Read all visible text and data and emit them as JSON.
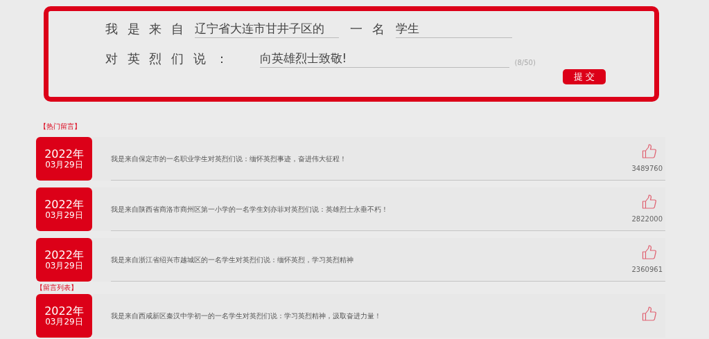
{
  "form": {
    "from_label": "我 是 来 自",
    "from_value": "辽宁省大连市甘井子区的",
    "role_label": "一 名",
    "role_value": "学生",
    "say_label": "对 英 烈 们 说 ：",
    "message_value": "向英雄烈士致敬!",
    "counter": "(8/50)",
    "submit": "提 交"
  },
  "sections": [
    {
      "title": "【热门留言】",
      "messages": [
        {
          "year": "2022年",
          "date": "03月29日",
          "text": "我是来自保定市的一名职业学生对英烈们说：缅怀英烈事迹，奋进伟大征程！",
          "likes": "3489760"
        },
        {
          "year": "2022年",
          "date": "03月29日",
          "text": "我是来自陕西省商洛市商州区第一小学的一名学生刘亦菲对英烈们说：英雄烈士永垂不朽！",
          "likes": "2822000"
        },
        {
          "year": "2022年",
          "date": "03月29日",
          "text": "我是来自浙江省绍兴市越城区的一名学生对英烈们说：缅怀英烈，学习英烈精神",
          "likes": "2360961"
        }
      ]
    },
    {
      "title": "【留言列表】",
      "messages": [
        {
          "year": "2022年",
          "date": "03月29日",
          "text": "我是来自西咸新区秦汉中学初一的一名学生对英烈们说：学习英烈精神，汲取奋进力量！"
        }
      ]
    }
  ]
}
